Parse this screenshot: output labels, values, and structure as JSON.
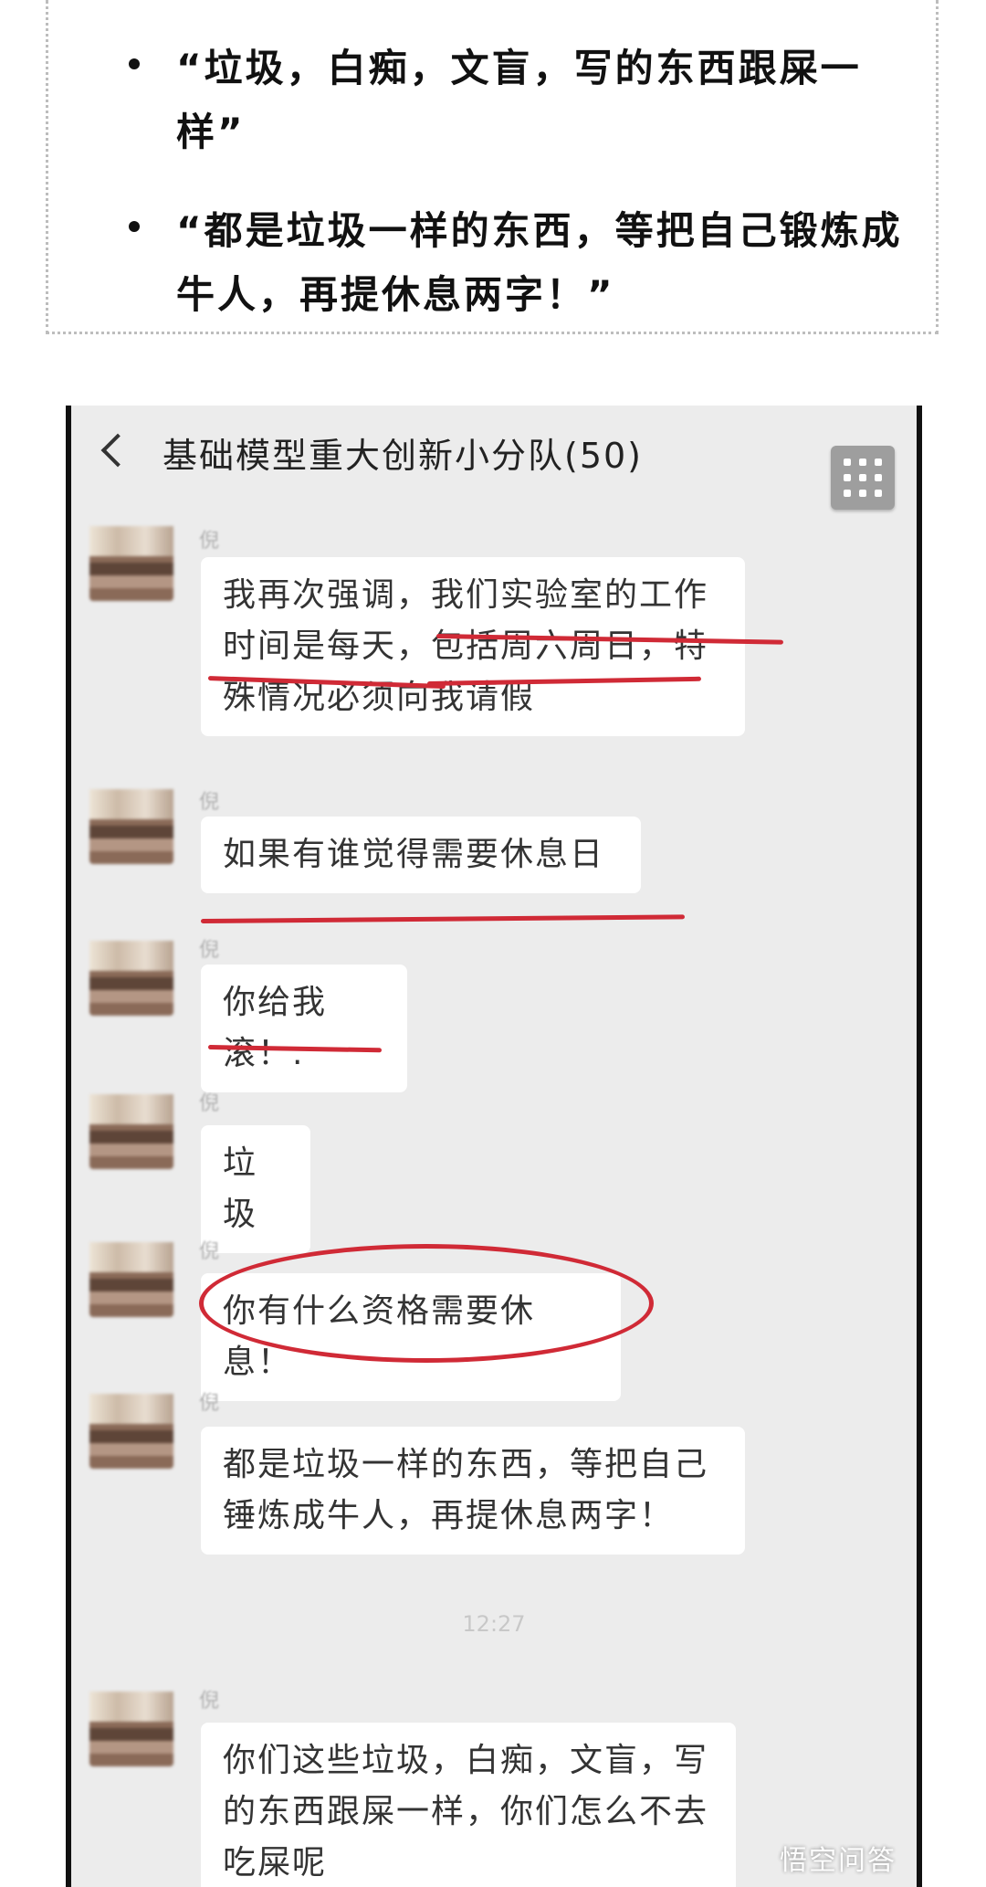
{
  "quotes": [
    {
      "text": "“垃圾，白痴，文盲，写的东西跟屎一样”"
    },
    {
      "text": "“都是垃圾一样的东西，等把自己锻炼成牛人，再提休息两字！”"
    }
  ],
  "chat": {
    "title": "基础模型重大创新小分队(50)",
    "messages": [
      {
        "sender": "倪",
        "text": "我再次强调，我们实验室的工作时间是每天，包括周六周日，特殊情况必须向我请假"
      },
      {
        "sender": "倪",
        "text": "如果有谁觉得需要休息日"
      },
      {
        "sender": "倪",
        "text": "你给我滚！."
      },
      {
        "sender": "倪",
        "text": "垃圾"
      },
      {
        "sender": "倪",
        "text": "你有什么资格需要休息！"
      },
      {
        "sender": "倪",
        "text": "都是垃圾一样的东西，等把自己锤炼成牛人，再提休息两字！"
      },
      {
        "sender": "倪",
        "text": "你们这些垃圾，白痴，文盲，写的东西跟屎一样，你们怎么不去吃屎呢"
      }
    ],
    "time_label": "12:27"
  },
  "watermark": "悟空问答",
  "colors": {
    "annotation": "#d02a36",
    "chat_bg": "#ececec",
    "bubble": "#ffffff"
  }
}
